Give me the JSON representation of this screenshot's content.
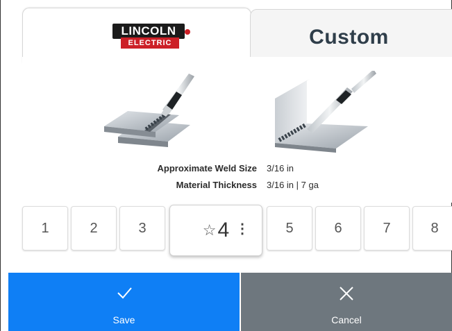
{
  "tabs": {
    "lincoln": {
      "logo_top": "LINCOLN",
      "logo_bottom": "ELECTRIC"
    },
    "custom": {
      "label": "Custom"
    }
  },
  "weld_info": {
    "size_label": "Approximate Weld Size",
    "size_value": "3/16 in",
    "thickness_label": "Material Thickness",
    "thickness_value": "3/16 in | 7 ga"
  },
  "slots": {
    "s1": "1",
    "s2": "2",
    "s3": "3",
    "s4": "4",
    "s5": "5",
    "s6": "6",
    "s7": "7",
    "s8": "8"
  },
  "icons": {
    "star": "star-outline-icon",
    "more": "more-vertical-icon",
    "save": "checkmark-icon",
    "cancel": "close-icon"
  },
  "buttons": {
    "save_label": "Save",
    "cancel_label": "Cancel"
  },
  "colors": {
    "save": "#0f7ff5",
    "cancel": "#6e777e",
    "brand_red": "#cc2027"
  }
}
